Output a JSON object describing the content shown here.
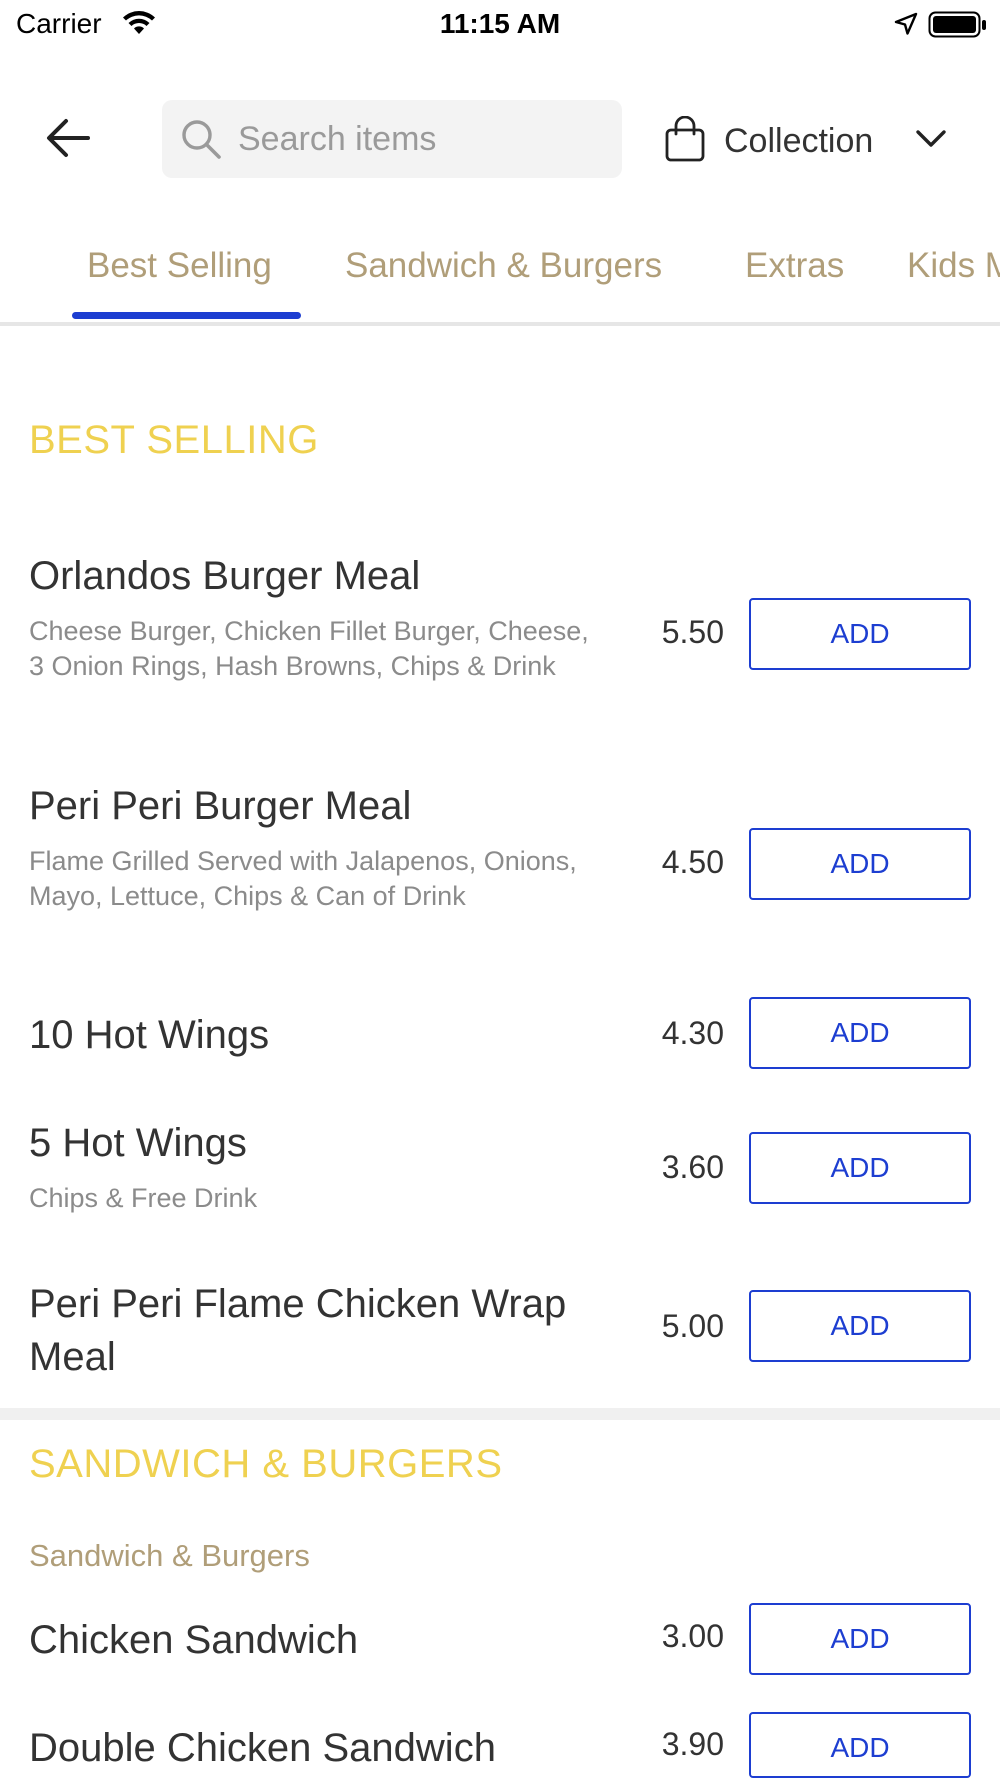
{
  "status_bar": {
    "carrier": "Carrier",
    "time": "11:15 AM"
  },
  "header": {
    "search_placeholder": "Search items",
    "order_mode": "Collection"
  },
  "tabs": [
    {
      "label": "Best Selling",
      "active": true
    },
    {
      "label": "Sandwich & Burgers",
      "active": false
    },
    {
      "label": "Extras",
      "active": false
    },
    {
      "label": "Kids M",
      "active": false
    }
  ],
  "sections": [
    {
      "title": "BEST SELLING",
      "items": [
        {
          "name": "Orlandos Burger Meal",
          "description": "Cheese Burger, Chicken Fillet Burger, Cheese, 3 Onion Rings, Hash Browns, Chips & Drink",
          "price": "5.50",
          "button": "ADD"
        },
        {
          "name": "Peri Peri Burger Meal",
          "description": "Flame Grilled  Served with Jalapenos, Onions, Mayo, Lettuce, Chips & Can of Drink",
          "price": "4.50",
          "button": "ADD"
        },
        {
          "name": "10 Hot Wings",
          "description": "",
          "price": "4.30",
          "button": "ADD"
        },
        {
          "name": "5 Hot Wings",
          "description": "Chips & Free Drink",
          "price": "3.60",
          "button": "ADD"
        },
        {
          "name": "Peri Peri Flame Chicken Wrap Meal",
          "description": "",
          "price": "5.00",
          "button": "ADD"
        }
      ]
    },
    {
      "title": "SANDWICH & BURGERS",
      "subtitle": "Sandwich & Burgers",
      "items": [
        {
          "name": "Chicken Sandwich",
          "description": "",
          "price": "3.00",
          "button": "ADD"
        },
        {
          "name": "Double Chicken Sandwich",
          "description": "",
          "price": "3.90",
          "button": "ADD"
        }
      ]
    }
  ],
  "colors": {
    "accent_blue": "#1d3ed1",
    "section_yellow": "#efd150",
    "tab_tan": "#b09e79"
  }
}
